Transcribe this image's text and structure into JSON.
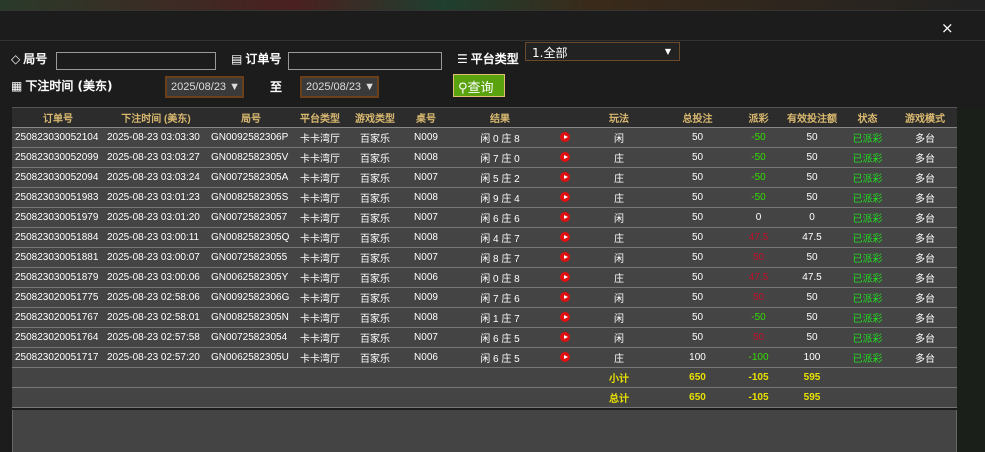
{
  "dialog": {
    "close": "×"
  },
  "filters": {
    "round_label": "局号",
    "round_value": "",
    "order_label": "订单号",
    "order_value": "",
    "platform_label": "平台类型",
    "platform_value": "1.全部",
    "time_label": "下注时间 (美东)",
    "date_from": "2025/08/23",
    "to_label": "至",
    "date_to": "2025/08/23",
    "query_label": "查询"
  },
  "table": {
    "headers": [
      "订单号",
      "下注时间 (美东)",
      "局号",
      "平台类型",
      "游戏类型",
      "桌号",
      "结果",
      "",
      "玩法",
      "总投注",
      "派彩",
      "有效投注额",
      "状态",
      "游戏模式"
    ],
    "rows": [
      [
        "250823030052104",
        "2025-08-23 03:03:30",
        "GN0092582306P",
        "卡卡湾厅",
        "百家乐",
        "N009",
        "闲 0 庄 8",
        "闲",
        "50",
        "-50",
        "50",
        "已派彩",
        "多台"
      ],
      [
        "250823030052099",
        "2025-08-23 03:03:27",
        "GN0082582305V",
        "卡卡湾厅",
        "百家乐",
        "N008",
        "闲 7 庄 0",
        "庄",
        "50",
        "-50",
        "50",
        "已派彩",
        "多台"
      ],
      [
        "250823030052094",
        "2025-08-23 03:03:24",
        "GN0072582305A",
        "卡卡湾厅",
        "百家乐",
        "N007",
        "闲 5 庄 2",
        "庄",
        "50",
        "-50",
        "50",
        "已派彩",
        "多台"
      ],
      [
        "250823030051983",
        "2025-08-23 03:01:23",
        "GN0082582305S",
        "卡卡湾厅",
        "百家乐",
        "N008",
        "闲 9 庄 4",
        "庄",
        "50",
        "-50",
        "50",
        "已派彩",
        "多台"
      ],
      [
        "250823030051979",
        "2025-08-23 03:01:20",
        "GN00725823057",
        "卡卡湾厅",
        "百家乐",
        "N007",
        "闲 6 庄 6",
        "闲",
        "50",
        "0",
        "0",
        "已派彩",
        "多台"
      ],
      [
        "250823030051884",
        "2025-08-23 03:00:11",
        "GN0082582305Q",
        "卡卡湾厅",
        "百家乐",
        "N008",
        "闲 4 庄 7",
        "庄",
        "50",
        "47.5",
        "47.5",
        "已派彩",
        "多台"
      ],
      [
        "250823030051881",
        "2025-08-23 03:00:07",
        "GN00725823055",
        "卡卡湾厅",
        "百家乐",
        "N007",
        "闲 8 庄 7",
        "闲",
        "50",
        "50",
        "50",
        "已派彩",
        "多台"
      ],
      [
        "250823030051879",
        "2025-08-23 03:00:06",
        "GN0062582305Y",
        "卡卡湾厅",
        "百家乐",
        "N006",
        "闲 0 庄 8",
        "庄",
        "50",
        "47.5",
        "47.5",
        "已派彩",
        "多台"
      ],
      [
        "250823020051775",
        "2025-08-23 02:58:06",
        "GN0092582306G",
        "卡卡湾厅",
        "百家乐",
        "N009",
        "闲 7 庄 6",
        "闲",
        "50",
        "50",
        "50",
        "已派彩",
        "多台"
      ],
      [
        "250823020051767",
        "2025-08-23 02:58:01",
        "GN0082582305N",
        "卡卡湾厅",
        "百家乐",
        "N008",
        "闲 1 庄 7",
        "闲",
        "50",
        "-50",
        "50",
        "已派彩",
        "多台"
      ],
      [
        "250823020051764",
        "2025-08-23 02:57:58",
        "GN00725823054",
        "卡卡湾厅",
        "百家乐",
        "N007",
        "闲 6 庄 5",
        "闲",
        "50",
        "50",
        "50",
        "已派彩",
        "多台"
      ],
      [
        "250823020051717",
        "2025-08-23 02:57:20",
        "GN0062582305U",
        "卡卡湾厅",
        "百家乐",
        "N006",
        "闲 6 庄 5",
        "庄",
        "100",
        "-100",
        "100",
        "已派彩",
        "多台"
      ]
    ],
    "subtotal": {
      "label": "小计",
      "bet": "650",
      "payout": "-105",
      "valid": "595"
    },
    "total": {
      "label": "总计",
      "bet": "650",
      "payout": "-105",
      "valid": "595"
    }
  },
  "colors": {
    "win": "#c0102a",
    "loss": "#33dd00",
    "status": "#22dd22",
    "accent": "#5aa20e",
    "header_text": "#d8b870",
    "sum_text": "#e8e000"
  }
}
